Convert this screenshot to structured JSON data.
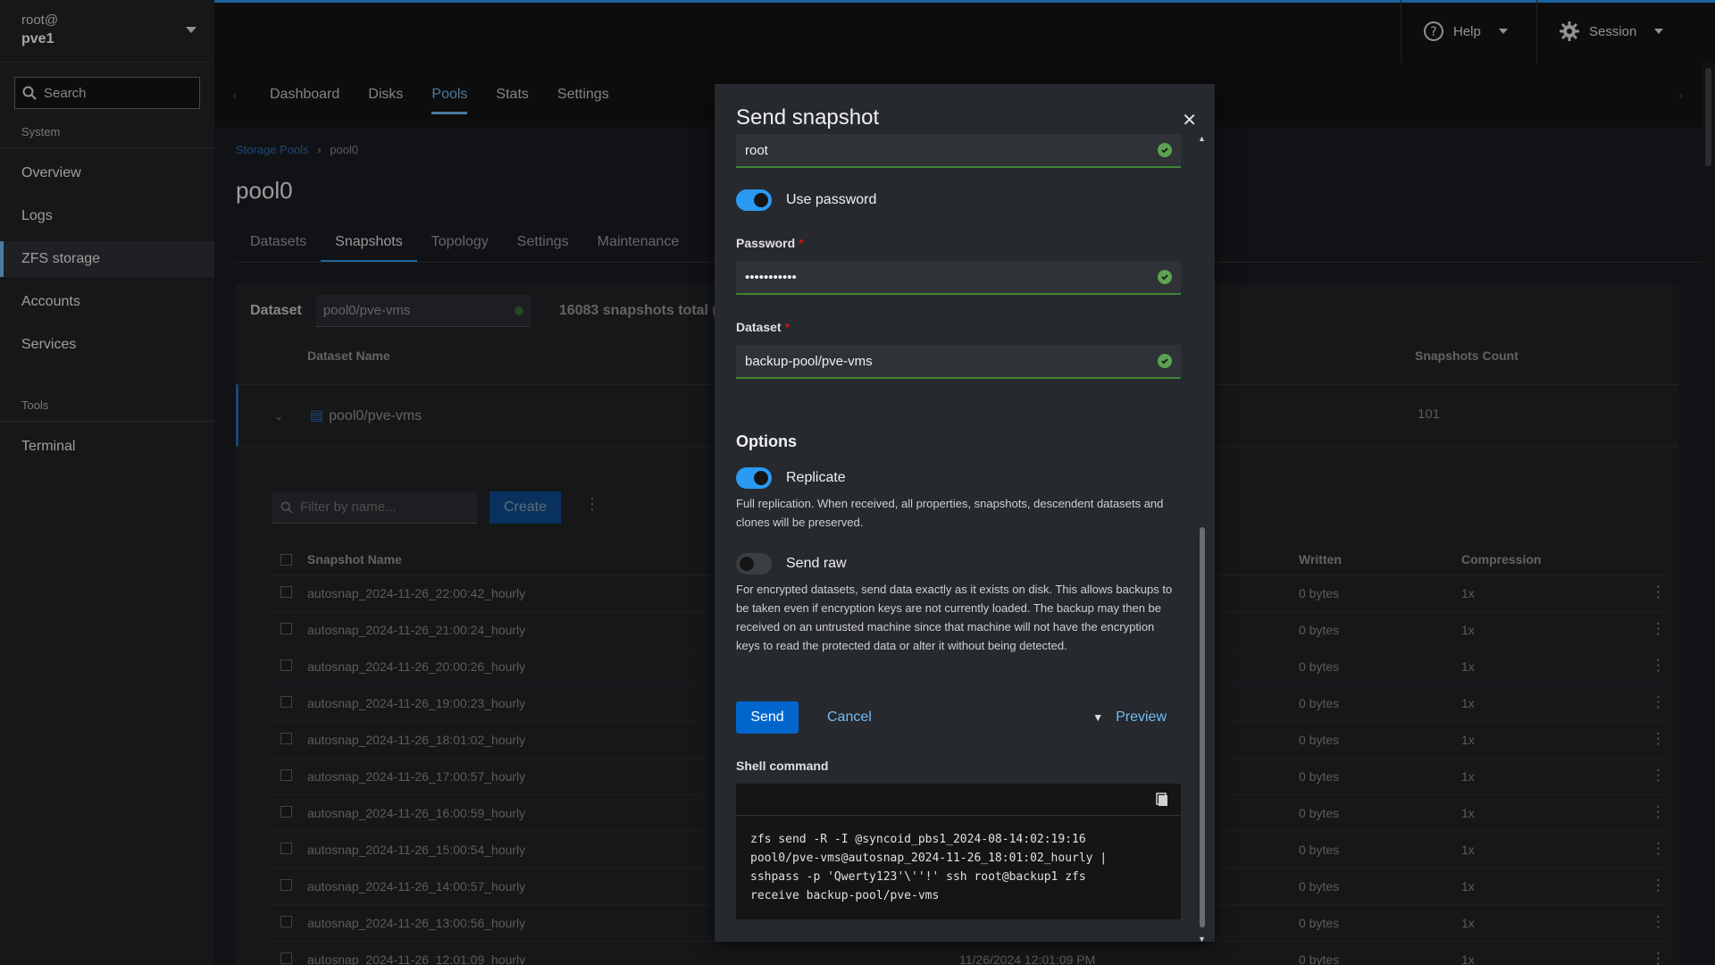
{
  "host": {
    "user": "root@",
    "name": "pve1"
  },
  "sidebar": {
    "search": "Search",
    "system_label": "System",
    "items": [
      "Overview",
      "Logs",
      "ZFS storage",
      "Accounts",
      "Services"
    ],
    "tools_label": "Tools",
    "tools_items": [
      "Terminal"
    ]
  },
  "masthead": {
    "help": "Help",
    "session": "Session"
  },
  "tabs": [
    "Dashboard",
    "Disks",
    "Pools",
    "Stats",
    "Settings"
  ],
  "breadcrumb": {
    "parent": "Storage Pools",
    "current": "pool0"
  },
  "page_title": "pool0",
  "subtabs": [
    "Datasets",
    "Snapshots",
    "Topology",
    "Settings",
    "Maintenance"
  ],
  "toolbar": {
    "dataset_label": "Dataset",
    "dataset_value": "pool0/pve-vms",
    "total": "16083 snapshots total ("
  },
  "dataset_table": {
    "col_name": "Dataset Name",
    "col_count": "Snapshots Count",
    "row_name": "pool0/pve-vms",
    "row_count": "101"
  },
  "snapshots": {
    "filter_placeholder": "Filter by name...",
    "create": "Create",
    "col_name": "Snapshot Name",
    "col_written": "Written",
    "col_compression": "Compression",
    "rows": [
      {
        "name": "autosnap_2024-11-26_22:00:42_hourly",
        "written": "0 bytes",
        "comp": "1x"
      },
      {
        "name": "autosnap_2024-11-26_21:00:24_hourly",
        "written": "0 bytes",
        "comp": "1x"
      },
      {
        "name": "autosnap_2024-11-26_20:00:26_hourly",
        "written": "0 bytes",
        "comp": "1x"
      },
      {
        "name": "autosnap_2024-11-26_19:00:23_hourly",
        "written": "0 bytes",
        "comp": "1x"
      },
      {
        "name": "autosnap_2024-11-26_18:01:02_hourly",
        "written": "0 bytes",
        "comp": "1x"
      },
      {
        "name": "autosnap_2024-11-26_17:00:57_hourly",
        "written": "0 bytes",
        "comp": "1x"
      },
      {
        "name": "autosnap_2024-11-26_16:00:59_hourly",
        "written": "0 bytes",
        "comp": "1x"
      },
      {
        "name": "autosnap_2024-11-26_15:00:54_hourly",
        "written": "0 bytes",
        "comp": "1x"
      },
      {
        "name": "autosnap_2024-11-26_14:00:57_hourly",
        "written": "0 bytes",
        "comp": "1x"
      },
      {
        "name": "autosnap_2024-11-26_13:00:56_hourly",
        "written": "0 bytes",
        "comp": "1x"
      },
      {
        "name": "autosnap_2024-11-26_12:01:09_hourly",
        "written": "0 bytes",
        "comp": "1x",
        "date": "11/26/2024 12:01:09 PM"
      }
    ]
  },
  "modal": {
    "title": "Send snapshot",
    "user_value": "root",
    "use_password": "Use password",
    "password_label": "Password",
    "password_value": "•••••••••••",
    "dataset_label": "Dataset",
    "dataset_value": "backup-pool/pve-vms",
    "options_label": "Options",
    "replicate_label": "Replicate",
    "replicate_help": "Full replication. When received, all properties, snapshots, descendent datasets and clones will be preserved.",
    "sendraw_label": "Send raw",
    "sendraw_help": "For encrypted datasets, send data exactly as it exists on disk. This allows backups to be taken even if encryption keys are not currently loaded. The backup may then be received on an untrusted machine since that machine will not have the encryption keys to read the protected data or alter it without being detected.",
    "send": "Send",
    "cancel": "Cancel",
    "preview": "Preview",
    "shell_label": "Shell command",
    "shell_command": "zfs send -R -I @syncoid_pbs1_2024-08-14:02:19:16\npool0/pve-vms@autosnap_2024-11-26_18:01:02_hourly |\nsshpass -p 'Qwerty123'\\''!' ssh root@backup1 zfs\nreceive backup-pool/pve-vms"
  },
  "colors": {
    "accent": "#2b9af3",
    "success": "#3e8635",
    "primary": "#0066cc",
    "link": "#73bcf7"
  }
}
